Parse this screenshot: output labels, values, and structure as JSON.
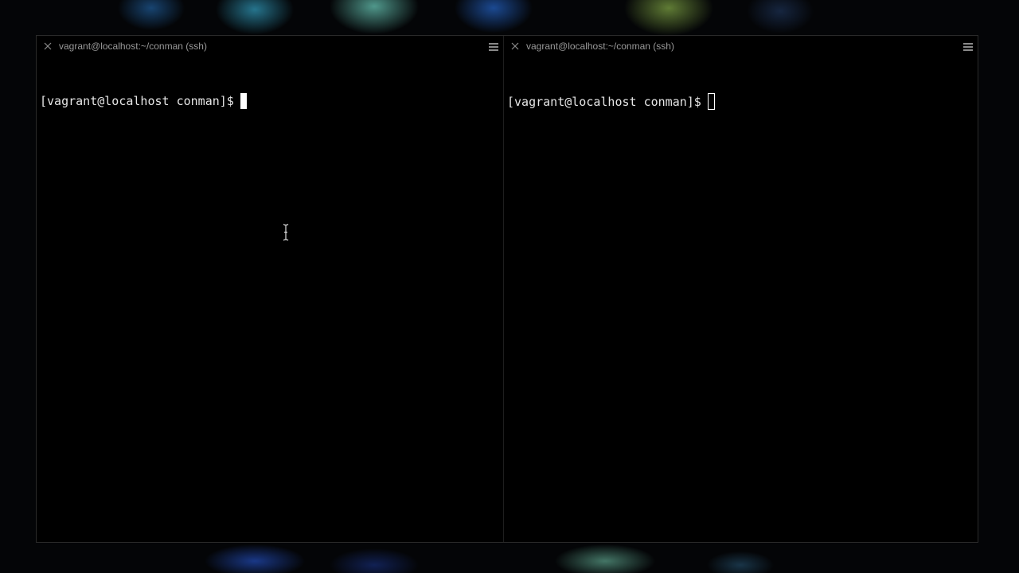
{
  "terminal": {
    "panes": [
      {
        "title": "vagrant@localhost:~/conman (ssh)",
        "prompt": "[vagrant@localhost conman]$",
        "cursor": "block-focused"
      },
      {
        "title": "vagrant@localhost:~/conman (ssh)",
        "prompt": "[vagrant@localhost conman]$",
        "cursor": "hollow-unfocused"
      }
    ],
    "icons": {
      "close": "close-icon",
      "menu": "hamburger-menu-icon",
      "mouse": "text-ibeam-cursor-icon"
    },
    "colors": {
      "background": "#000000",
      "text": "#e6e6e6",
      "header_text": "#9a9a9a"
    }
  }
}
